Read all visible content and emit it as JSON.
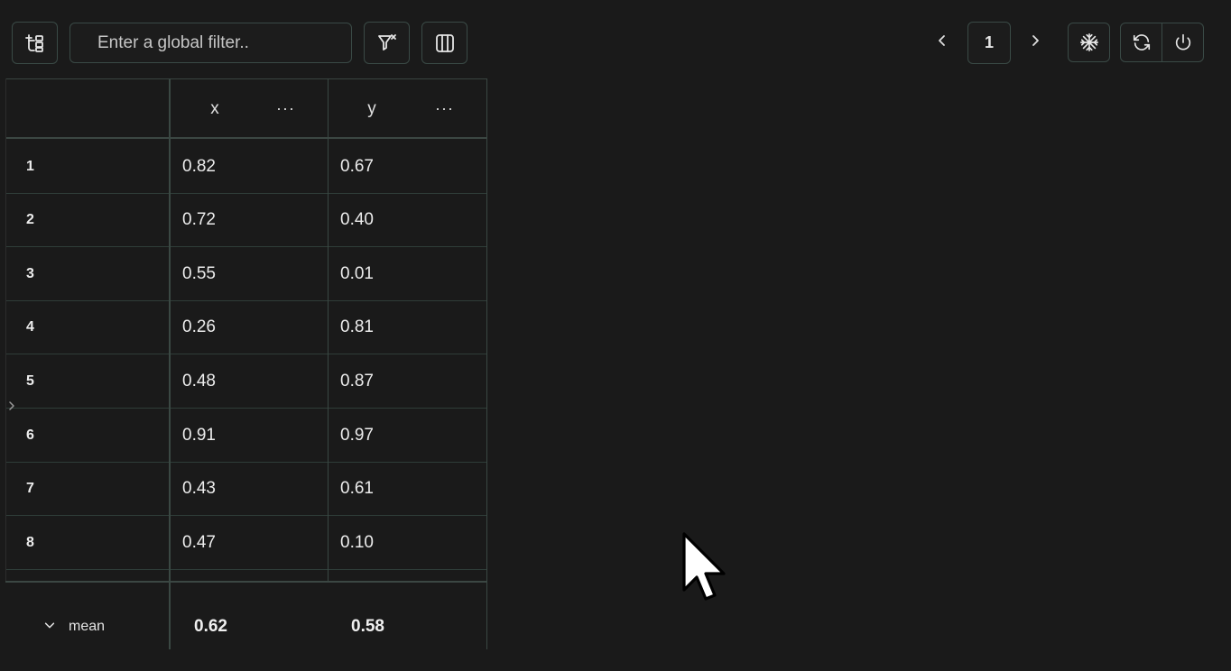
{
  "toolbar": {
    "filter_placeholder": "Enter a global filter..",
    "icons": {
      "tree": "tree-structure-icon",
      "clear_filter": "filter-clear-icon",
      "columns": "columns-icon",
      "prev": "chevron-left-icon",
      "next": "chevron-right-icon",
      "freeze": "snowflake-icon",
      "refresh": "refresh-icon",
      "power": "power-icon"
    }
  },
  "pagination": {
    "page": "1"
  },
  "table": {
    "columns": [
      {
        "name": "x",
        "menu": "···"
      },
      {
        "name": "y",
        "menu": "···"
      }
    ],
    "rows": [
      {
        "index": "1",
        "x": "0.82",
        "y": "0.67"
      },
      {
        "index": "2",
        "x": "0.72",
        "y": "0.40"
      },
      {
        "index": "3",
        "x": "0.55",
        "y": "0.01"
      },
      {
        "index": "4",
        "x": "0.26",
        "y": "0.81"
      },
      {
        "index": "5",
        "x": "0.48",
        "y": "0.87"
      },
      {
        "index": "6",
        "x": "0.91",
        "y": "0.97"
      },
      {
        "index": "7",
        "x": "0.43",
        "y": "0.61"
      },
      {
        "index": "8",
        "x": "0.47",
        "y": "0.10"
      }
    ],
    "footer": {
      "aggregation": "mean",
      "x": "0.62",
      "y": "0.58"
    }
  },
  "colors": {
    "background": "#1a1a1a",
    "border_accent": "#3a4a46",
    "grid_line": "#2f3d39",
    "text": "#e8e8e8"
  }
}
